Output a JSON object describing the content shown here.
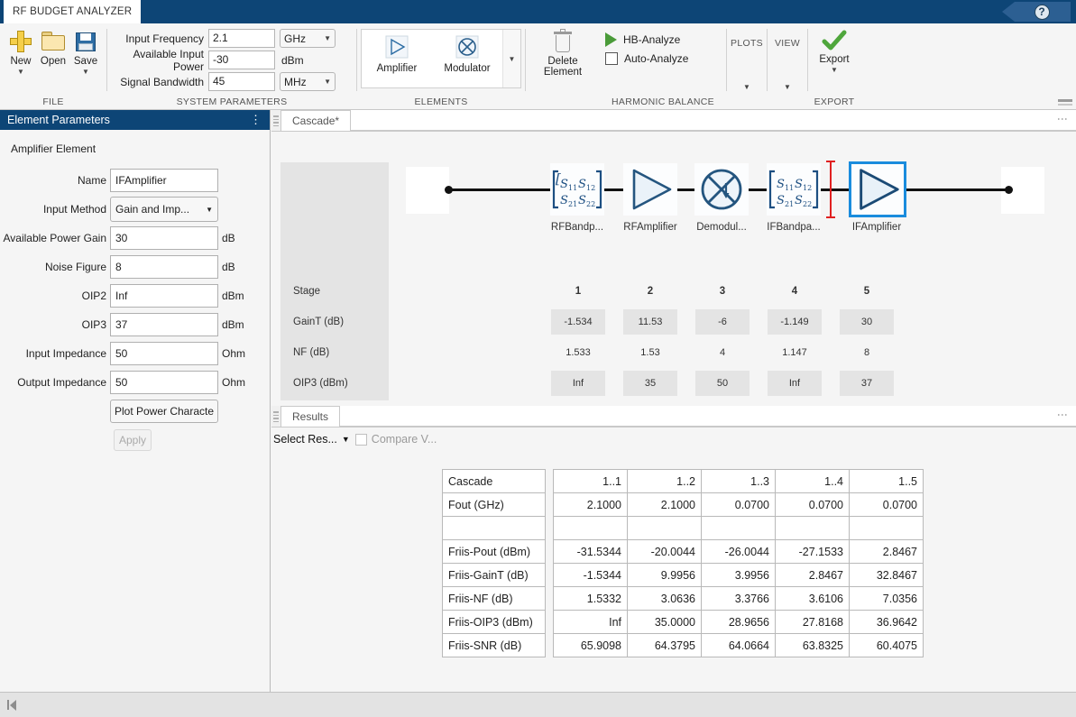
{
  "titlebar": {
    "app_tab": "RF BUDGET ANALYZER",
    "help_icon": "help-icon",
    "help_glyph": "?"
  },
  "ribbon": {
    "file": {
      "group_label": "FILE",
      "buttons": [
        {
          "label": "New",
          "icon": "new-file-icon",
          "has_caret": true
        },
        {
          "label": "Open",
          "icon": "open-folder-icon",
          "has_caret": false
        },
        {
          "label": "Save",
          "icon": "save-disk-icon",
          "has_caret": true
        }
      ]
    },
    "system_parameters": {
      "group_label": "SYSTEM PARAMETERS",
      "fields": [
        {
          "label": "Input Frequency",
          "value": "2.1",
          "unit": "GHz",
          "unit_is_dropdown": true
        },
        {
          "label": "Available Input Power",
          "value": "-30",
          "unit": "dBm",
          "unit_is_dropdown": false
        },
        {
          "label": "Signal Bandwidth",
          "value": "45",
          "unit": "MHz",
          "unit_is_dropdown": true
        }
      ]
    },
    "elements": {
      "group_label": "ELEMENTS",
      "buttons": [
        {
          "label": "Amplifier",
          "icon": "amplifier-icon"
        },
        {
          "label": "Modulator",
          "icon": "modulator-icon"
        }
      ],
      "more_caret": "chevron-down-icon"
    },
    "harmonic_balance": {
      "group_label": "HARMONIC BALANCE",
      "delete_label_line1": "Delete",
      "delete_label_line2": "Element",
      "delete_icon": "trash-icon",
      "hb_analyze_label": "HB-Analyze",
      "hb_analyze_icon": "play-icon",
      "auto_analyze_label": "Auto-Analyze",
      "auto_analyze_checked": false
    },
    "plots": {
      "group_label": "PLOTS",
      "caret": "chevron-down-icon"
    },
    "view": {
      "group_label": "VIEW",
      "caret": "chevron-down-icon"
    },
    "export": {
      "group_label": "EXPORT",
      "label": "Export",
      "icon": "checkmark-icon",
      "caret": "chevron-down-icon"
    }
  },
  "element_parameters": {
    "panel_title": "Element Parameters",
    "menu_icon": "kebab-menu-icon",
    "subtitle": "Amplifier Element",
    "fields": [
      {
        "label": "Name",
        "value": "IFAmplifier",
        "unit": "",
        "type": "text"
      },
      {
        "label": "Input Method",
        "value": "Gain and Imp...",
        "unit": "",
        "type": "select"
      },
      {
        "label": "Available Power Gain",
        "value": "30",
        "unit": "dB",
        "type": "text"
      },
      {
        "label": "Noise Figure",
        "value": "8",
        "unit": "dB",
        "type": "text"
      },
      {
        "label": "OIP2",
        "value": "Inf",
        "unit": "dBm",
        "type": "text"
      },
      {
        "label": "OIP3",
        "value": "37",
        "unit": "dBm",
        "type": "text"
      },
      {
        "label": "Input Impedance",
        "value": "50",
        "unit": "Ohm",
        "type": "text"
      },
      {
        "label": "Output Impedance",
        "value": "50",
        "unit": "Ohm",
        "type": "text"
      }
    ],
    "plot_button": "Plot Power Characte",
    "apply_button": "Apply"
  },
  "cascade": {
    "tab_label": "Cascade*",
    "menu_icon": "kebab-menu-icon",
    "blocks": [
      {
        "name": "RFBandp...",
        "icon": "s-parameter-icon",
        "selected": false
      },
      {
        "name": "RFAmplifier",
        "icon": "amplifier-icon",
        "selected": false
      },
      {
        "name": "Demodul...",
        "icon": "mixer-icon",
        "selected": false
      },
      {
        "name": "IFBandpa...",
        "icon": "s-parameter-icon",
        "selected": false
      },
      {
        "name": "IFAmplifier",
        "icon": "amplifier-icon",
        "selected": true
      }
    ],
    "insertion_marker": "red-insertion-marker",
    "stage_table": {
      "row_labels": [
        "Stage",
        "GainT (dB)",
        "NF (dB)",
        "OIP3 (dBm)"
      ],
      "stages": [
        "1",
        "2",
        "3",
        "4",
        "5"
      ],
      "gaint": [
        "-1.534",
        "11.53",
        "-6",
        "-1.149",
        "30"
      ],
      "nf": [
        "1.533",
        "1.53",
        "4",
        "1.147",
        "8"
      ],
      "oip3": [
        "Inf",
        "35",
        "50",
        "Inf",
        "37"
      ]
    }
  },
  "results": {
    "tab_label": "Results",
    "menu_icon": "kebab-menu-icon",
    "select_results_label": "Select Res...",
    "select_caret": "chevron-down-icon",
    "compare_label": "Compare V...",
    "compare_checked": false,
    "table": {
      "row_labels": [
        "Cascade",
        "Fout (GHz)",
        "",
        "Friis-Pout (dBm)",
        "Friis-GainT (dB)",
        "Friis-NF (dB)",
        "Friis-OIP3 (dBm)",
        "Friis-SNR (dB)"
      ],
      "rows": [
        {
          "label": "Cascade",
          "values": [
            "1..1",
            "1..2",
            "1..3",
            "1..4",
            "1..5"
          ]
        },
        {
          "label": "Fout (GHz)",
          "values": [
            "2.1000",
            "2.1000",
            "0.0700",
            "0.0700",
            "0.0700"
          ]
        },
        {
          "label": "",
          "values": [
            "",
            "",
            "",
            "",
            ""
          ]
        },
        {
          "label": "Friis-Pout (dBm)",
          "values": [
            "-31.5344",
            "-20.0044",
            "-26.0044",
            "-27.1533",
            "2.8467"
          ]
        },
        {
          "label": "Friis-GainT (dB)",
          "values": [
            "-1.5344",
            "9.9956",
            "3.9956",
            "2.8467",
            "32.8467"
          ]
        },
        {
          "label": "Friis-NF (dB)",
          "values": [
            "1.5332",
            "3.0636",
            "3.3766",
            "3.6106",
            "7.0356"
          ]
        },
        {
          "label": "Friis-OIP3 (dBm)",
          "values": [
            "Inf",
            "35.0000",
            "28.9656",
            "27.8168",
            "36.9642"
          ]
        },
        {
          "label": "Friis-SNR (dB)",
          "values": [
            "65.9098",
            "64.3795",
            "64.0664",
            "63.8325",
            "60.4075"
          ]
        }
      ]
    }
  },
  "statusbar": {
    "collapse_icon": "collapse-panel-icon"
  },
  "colors": {
    "titlebar": "#0d4576",
    "accent_selected": "#1a8cdd",
    "marker_red": "#e02020",
    "ribbon_bg": "#f5f5f5"
  }
}
